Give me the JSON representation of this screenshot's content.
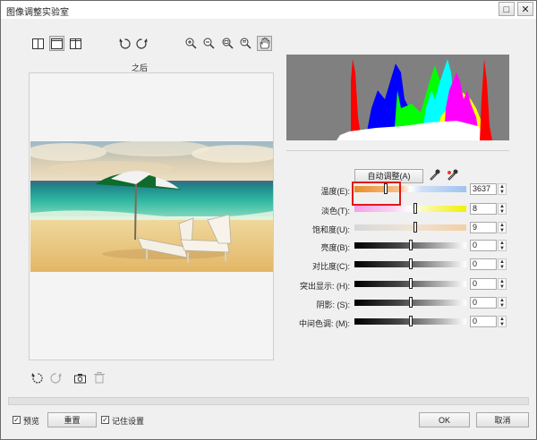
{
  "window": {
    "title": "图像调整实验室",
    "maximize_glyph": "□",
    "close_glyph": "✕"
  },
  "toolbar": {
    "view_icons": [
      "split-vertical-icon",
      "single-view-icon",
      "split-horizontal-icon"
    ],
    "rotate_icons": [
      "rotate-left-icon",
      "rotate-right-icon"
    ],
    "zoom_icons": [
      "zoom-in-icon",
      "zoom-out-icon",
      "zoom-fit-icon",
      "zoom-actual-icon",
      "pan-hand-icon"
    ]
  },
  "preview": {
    "label": "之后"
  },
  "auto_adjust": {
    "label": "自动调整(A)"
  },
  "sliders": [
    {
      "label": "温度(E):",
      "value": "3637",
      "position": 0.28
    },
    {
      "label": "淡色(T):",
      "value": "8",
      "position": 0.54
    },
    {
      "label": "饱和度(U):",
      "value": "9",
      "position": 0.54
    },
    {
      "label": "亮度(B):",
      "value": "0",
      "position": 0.5
    },
    {
      "label": "对比度(C):",
      "value": "0",
      "position": 0.5
    },
    {
      "label": "突出显示: (H):",
      "value": "0",
      "position": 0.5
    },
    {
      "label": "阴影: (S):",
      "value": "0",
      "position": 0.5
    },
    {
      "label": "中间色调: (M):",
      "value": "0",
      "position": 0.5
    }
  ],
  "footer": {
    "preview_label": "预览",
    "preview_checked": true,
    "reset_label": "重置",
    "remember_label": "记住设置",
    "remember_checked": true,
    "ok_label": "OK",
    "cancel_label": "取消"
  }
}
